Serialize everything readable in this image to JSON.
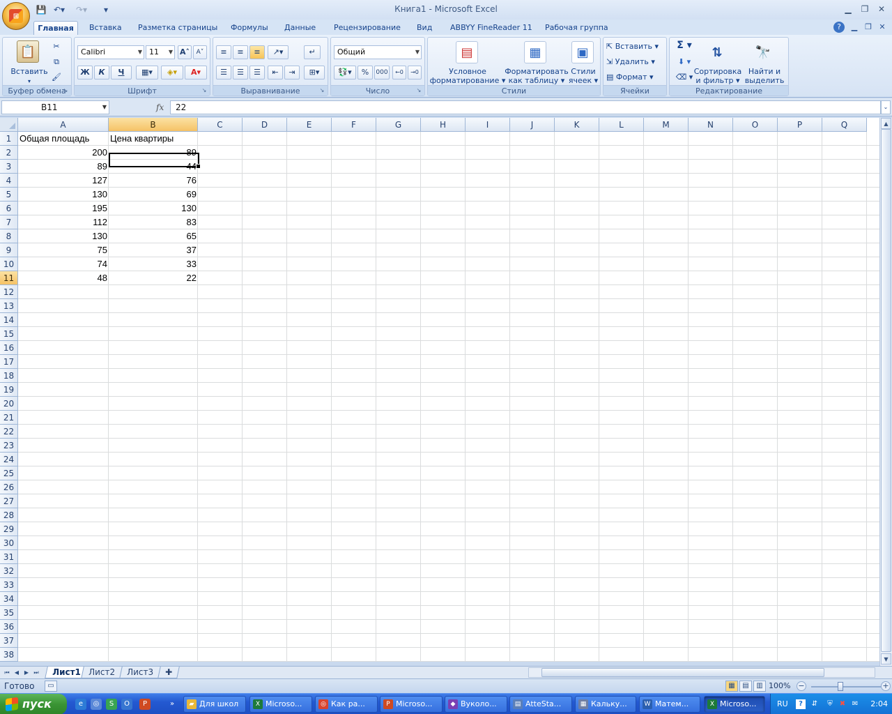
{
  "window": {
    "title": "Книга1 - Microsoft Excel"
  },
  "tabs": [
    {
      "label": "Главная",
      "active": true
    },
    {
      "label": "Вставка"
    },
    {
      "label": "Разметка страницы"
    },
    {
      "label": "Формулы"
    },
    {
      "label": "Данные"
    },
    {
      "label": "Рецензирование"
    },
    {
      "label": "Вид"
    },
    {
      "label": "ABBYY FineReader 11"
    },
    {
      "label": "Рабочая группа"
    }
  ],
  "ribbon": {
    "clipboard": {
      "group_label": "Буфер обмена",
      "paste_label": "Вставить"
    },
    "font": {
      "group_label": "Шрифт",
      "font_name": "Calibri",
      "font_size": "11",
      "bold": "Ж",
      "italic": "К",
      "underline": "Ч"
    },
    "alignment": {
      "group_label": "Выравнивание"
    },
    "number": {
      "group_label": "Число",
      "format": "Общий",
      "percent": "%",
      "thousands": "000"
    },
    "styles": {
      "group_label": "Стили",
      "conditional_line1": "Условное",
      "conditional_line2": "форматирование",
      "table_line1": "Форматировать",
      "table_line2": "как таблицу",
      "cellstyles_line1": "Стили",
      "cellstyles_line2": "ячеек"
    },
    "cells": {
      "group_label": "Ячейки",
      "insert": "Вставить",
      "delete": "Удалить",
      "format": "Формат"
    },
    "editing": {
      "group_label": "Редактирование",
      "sort_line1": "Сортировка",
      "sort_line2": "и фильтр",
      "find_line1": "Найти и",
      "find_line2": "выделить"
    }
  },
  "formula_bar": {
    "name_box": "B11",
    "fx": "fx",
    "value": "22"
  },
  "grid": {
    "columns": [
      "A",
      "B",
      "C",
      "D",
      "E",
      "F",
      "G",
      "H",
      "I",
      "J",
      "K",
      "L",
      "M",
      "N",
      "O",
      "P",
      "Q"
    ],
    "row_count": 38,
    "header_row": [
      "Общая площадь",
      "Цена квартиры"
    ],
    "rows": [
      [
        200,
        89
      ],
      [
        89,
        44
      ],
      [
        127,
        76
      ],
      [
        130,
        69
      ],
      [
        195,
        130
      ],
      [
        112,
        83
      ],
      [
        130,
        65
      ],
      [
        75,
        37
      ],
      [
        74,
        33
      ],
      [
        48,
        22
      ]
    ],
    "selected_cell": "B11"
  },
  "sheets": [
    {
      "label": "Лист1",
      "active": true
    },
    {
      "label": "Лист2"
    },
    {
      "label": "Лист3"
    }
  ],
  "status": {
    "text": "Готово",
    "zoom": "100%"
  },
  "taskbar": {
    "start_label": "пуск",
    "tasks": [
      {
        "label": "Для школ",
        "icon": "folder-icon"
      },
      {
        "label": "Microso...",
        "icon": "excel-icon"
      },
      {
        "label": "Как ра...",
        "icon": "chrome-icon"
      },
      {
        "label": "Microso...",
        "icon": "powerpoint-icon"
      },
      {
        "label": "Вуколо...",
        "icon": "app-icon"
      },
      {
        "label": "AtteSta...",
        "icon": "document-icon"
      },
      {
        "label": "Кальку...",
        "icon": "calculator-icon"
      },
      {
        "label": "Матем...",
        "icon": "word-icon"
      },
      {
        "label": "Microso...",
        "icon": "excel-icon",
        "active": true
      }
    ],
    "language": "RU",
    "clock": "2:04"
  },
  "colors": {
    "selection_header": "#f5c266",
    "grid_line": "#dadcdd",
    "taskbar_blue": "#2459d1",
    "start_green": "#3a9434"
  }
}
